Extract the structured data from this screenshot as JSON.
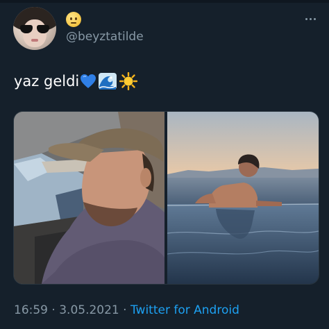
{
  "tweet": {
    "handle": "@beyztatilde",
    "text": "yaz geldi",
    "emojis": [
      "blue-heart",
      "water-wave",
      "sun"
    ],
    "time": "16:59",
    "date": "3.05.2021",
    "separator": "·",
    "source": "Twitter for Android"
  },
  "colors": {
    "background": "#15202b",
    "secondary_text": "#8899a6",
    "link": "#1da1f2"
  }
}
